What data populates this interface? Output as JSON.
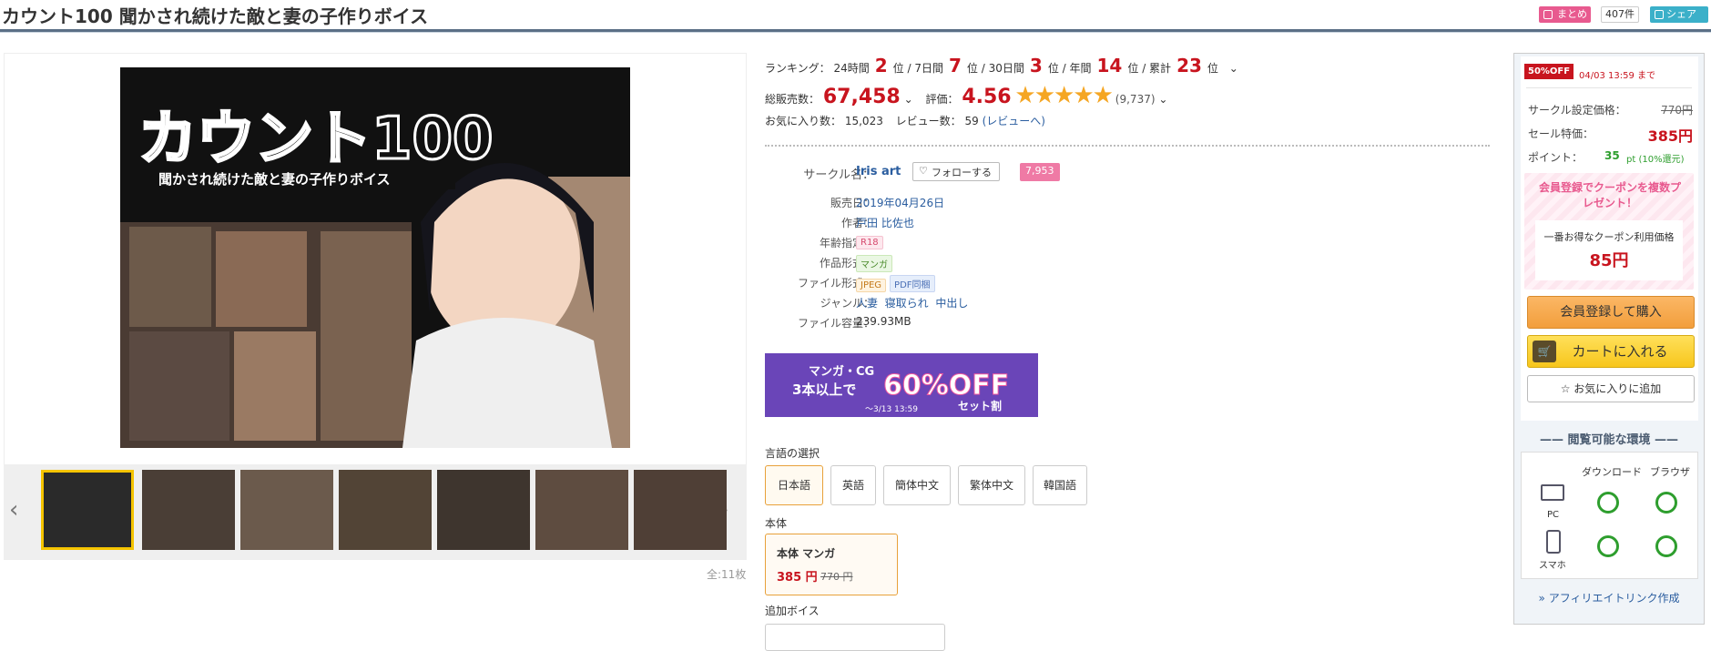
{
  "title": "カウント100 聞かされ続けた敵と妻の子作りボイス",
  "header": {
    "matome_label": "まとめ",
    "matome_count": "407件",
    "share_label": "シェア"
  },
  "gallery": {
    "cover_title": "カウント100",
    "cover_subtitle": "聞かされ続けた敵と妻の子作りボイス",
    "total": "全:11枚"
  },
  "ranking": {
    "label": "ランキング：",
    "items": [
      {
        "period": "24時間",
        "rank": "2",
        "unit": "位"
      },
      {
        "period": "7日間",
        "rank": "7",
        "unit": "位"
      },
      {
        "period": "30日間",
        "rank": "3",
        "unit": "位"
      },
      {
        "period": "年間",
        "rank": "14",
        "unit": "位"
      },
      {
        "period": "累計",
        "rank": "23",
        "unit": "位"
      }
    ]
  },
  "sales": {
    "label": "総販売数：",
    "value": "67,458",
    "rating_label": "評価：",
    "rating": "4.56",
    "stars": "★★★★★",
    "rating_count": "(9,737)"
  },
  "favorites": {
    "label": "お気に入り数：",
    "value": "15,023",
    "review_label": "レビュー数：",
    "review_value": "59",
    "review_link": "(レビューへ)"
  },
  "info": {
    "circle_label": "サークル名：",
    "circle": "Iris art",
    "follow_label": "フォローする",
    "follow_count": "7,953",
    "date_label": "販売日：",
    "date": "2019年04月26日",
    "author_label": "作者：",
    "author": "戸田 比佐也",
    "age_label": "年齢指定：",
    "age": "R18",
    "form_label": "作品形式：",
    "form": "マンガ",
    "file_label": "ファイル形式：",
    "file1": "JPEG",
    "file2": "PDF同梱",
    "genre_label": "ジャンル：",
    "genres": [
      "人妻",
      "寝取られ",
      "中出し"
    ],
    "size_label": "ファイル容量：",
    "size": "239.93MB"
  },
  "banner": {
    "line1": "マンガ・CG",
    "line2": "3本以上で",
    "pct": "60%OFF",
    "set": "セット割",
    "until": "〜3/13 13:59"
  },
  "language": {
    "label": "言語の選択",
    "options": [
      "日本語",
      "英語",
      "簡体中文",
      "繁体中文",
      "韓国語"
    ]
  },
  "honntai": {
    "label": "本体",
    "name": "本体 マンガ",
    "price": "385 円",
    "old": "770 円"
  },
  "voice_label": "追加ボイス",
  "side": {
    "off": "50%OFF",
    "until": "04/03 13:59 まで",
    "set_price_label": "サークル設定価格：",
    "set_price": "770円",
    "sale_label": "セール特価：",
    "sale": "385円",
    "point_label": "ポイント：",
    "point": "35",
    "point_unit": "pt (10%還元)",
    "coupon_title": "会員登録でクーポンを複数プレゼント！",
    "coupon_sub": "一番お得なクーポン利用価格",
    "coupon_price": "85円",
    "buy": "会員登録して購入",
    "cart": "カートに入れる",
    "fav": "お気に入りに追加",
    "env_title": "閲覧可能な環境",
    "col_dl": "ダウンロード",
    "col_br": "ブラウザ",
    "pc": "PC",
    "sp": "スマホ",
    "aff": "» アフィリエイトリンク作成"
  },
  "colors": {
    "accent_red": "#c8141e",
    "star": "#f5a623",
    "pink": "#e85a8f",
    "orange": "#f29e3c",
    "yellow": "#f7c61c",
    "ok_green": "#2e9e2e"
  }
}
